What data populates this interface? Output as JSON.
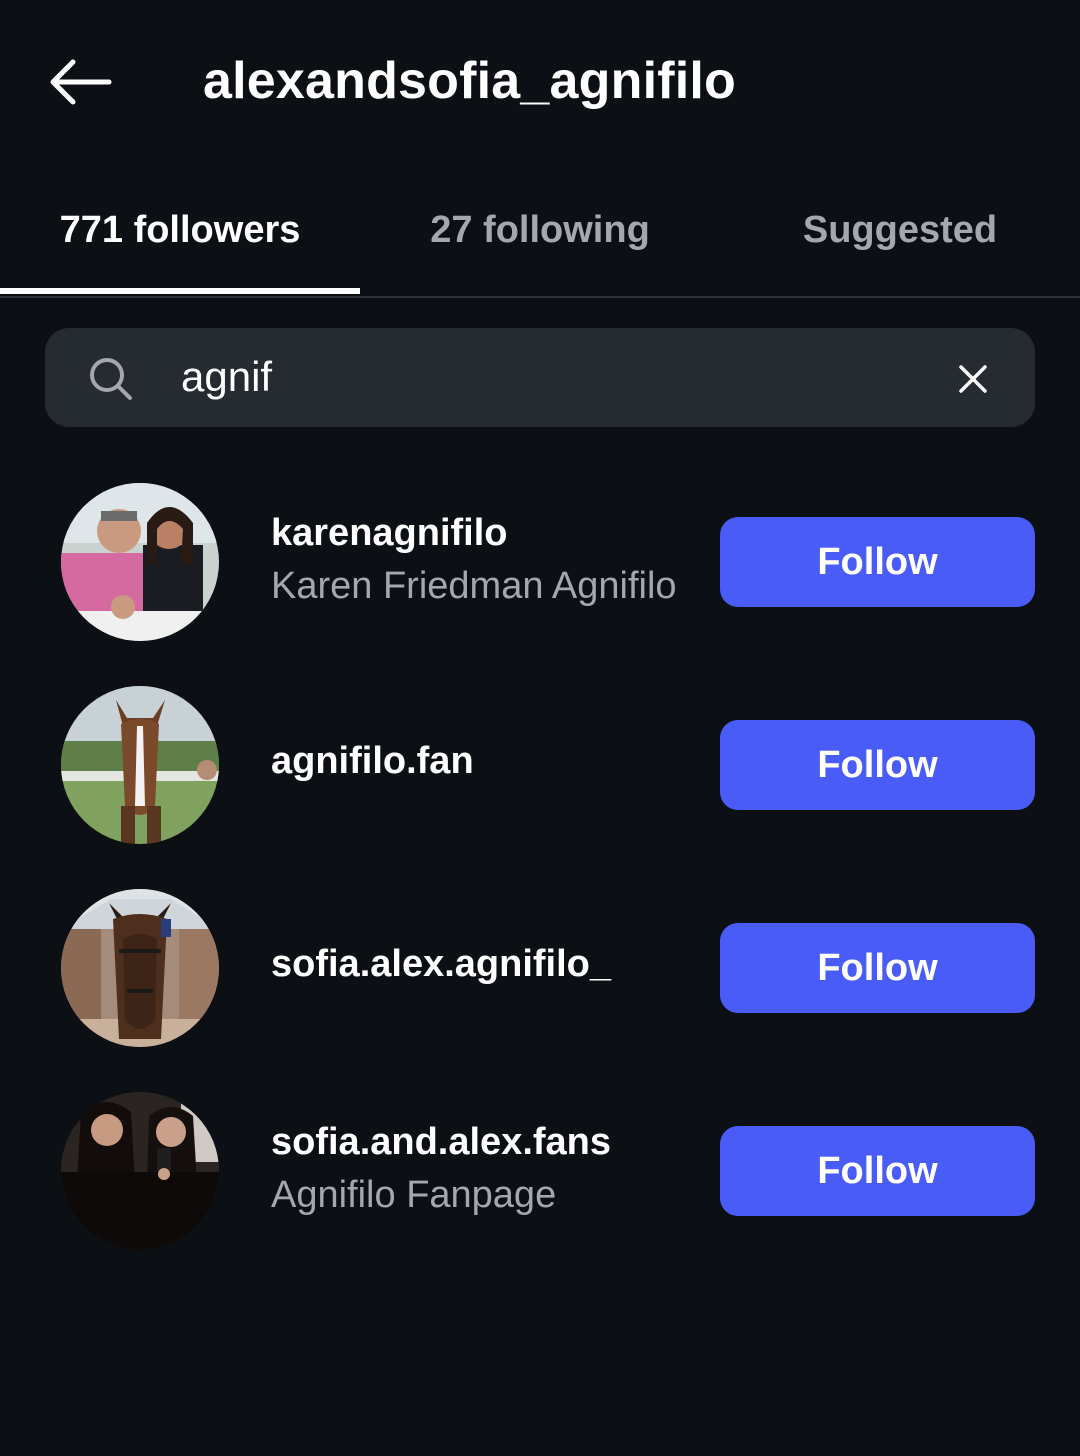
{
  "header": {
    "title": "alexandsofia_agnifilo",
    "back_icon": "arrow-left-icon"
  },
  "tabs": [
    {
      "label": "771 followers",
      "active": true
    },
    {
      "label": "27 following",
      "active": false
    },
    {
      "label": "Suggested",
      "active": false
    }
  ],
  "search": {
    "value": "agnif",
    "search_icon": "search-icon",
    "clear_icon": "close-icon"
  },
  "results": [
    {
      "username": "karenagnifilo",
      "fullname": "Karen Friedman Agnifilo",
      "button": "Follow"
    },
    {
      "username": "agnifilo.fan",
      "fullname": "",
      "button": "Follow"
    },
    {
      "username": "sofia.alex.agnifilo_",
      "fullname": "",
      "button": "Follow"
    },
    {
      "username": "sofia.and.alex.fans",
      "fullname": "Agnifilo Fanpage",
      "button": "Follow"
    }
  ],
  "colors": {
    "background": "#0c0f14",
    "search_bg": "#262a31",
    "button_bg": "#4a5cf7",
    "secondary_text": "#a4a8ae"
  }
}
